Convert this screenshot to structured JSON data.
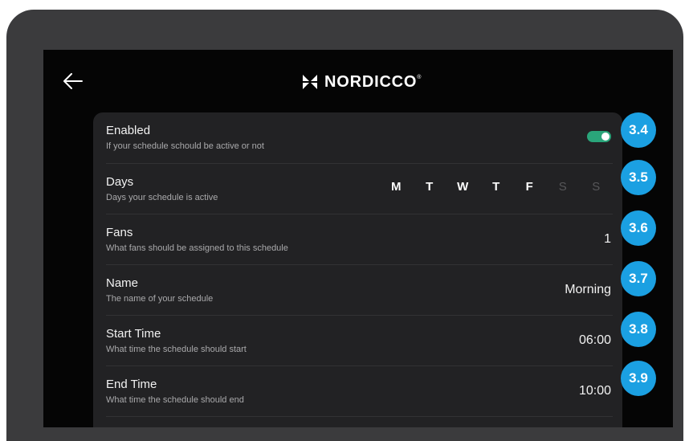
{
  "header": {
    "back_icon": "arrow-left-icon",
    "brand_name": "NORDICCO",
    "brand_mark": "®",
    "brand_icon": "nordicco-logo-icon"
  },
  "settings": [
    {
      "title": "Enabled",
      "description": "If your schedule schould be active or not",
      "control": "toggle",
      "enabled": true
    },
    {
      "title": "Days",
      "description": "Days your schedule is active",
      "control": "days",
      "days": [
        {
          "label": "M",
          "active": true
        },
        {
          "label": "T",
          "active": true
        },
        {
          "label": "W",
          "active": true
        },
        {
          "label": "T",
          "active": true
        },
        {
          "label": "F",
          "active": true
        },
        {
          "label": "S",
          "active": false
        },
        {
          "label": "S",
          "active": false
        }
      ]
    },
    {
      "title": "Fans",
      "description": "What fans should be assigned to this schedule",
      "value": "1"
    },
    {
      "title": "Name",
      "description": "The name of your schedule",
      "value": "Morning"
    },
    {
      "title": "Start Time",
      "description": "What time the schedule should start",
      "value": "06:00"
    },
    {
      "title": "End Time",
      "description": "What time the schedule should end",
      "value": "10:00"
    }
  ],
  "callouts": [
    "3.4",
    "3.5",
    "3.6",
    "3.7",
    "3.8",
    "3.9"
  ],
  "colors": {
    "toggle_on": "#2aa57a",
    "callout": "#1ba0e2",
    "panel": "#222224",
    "screen": "#050505"
  }
}
